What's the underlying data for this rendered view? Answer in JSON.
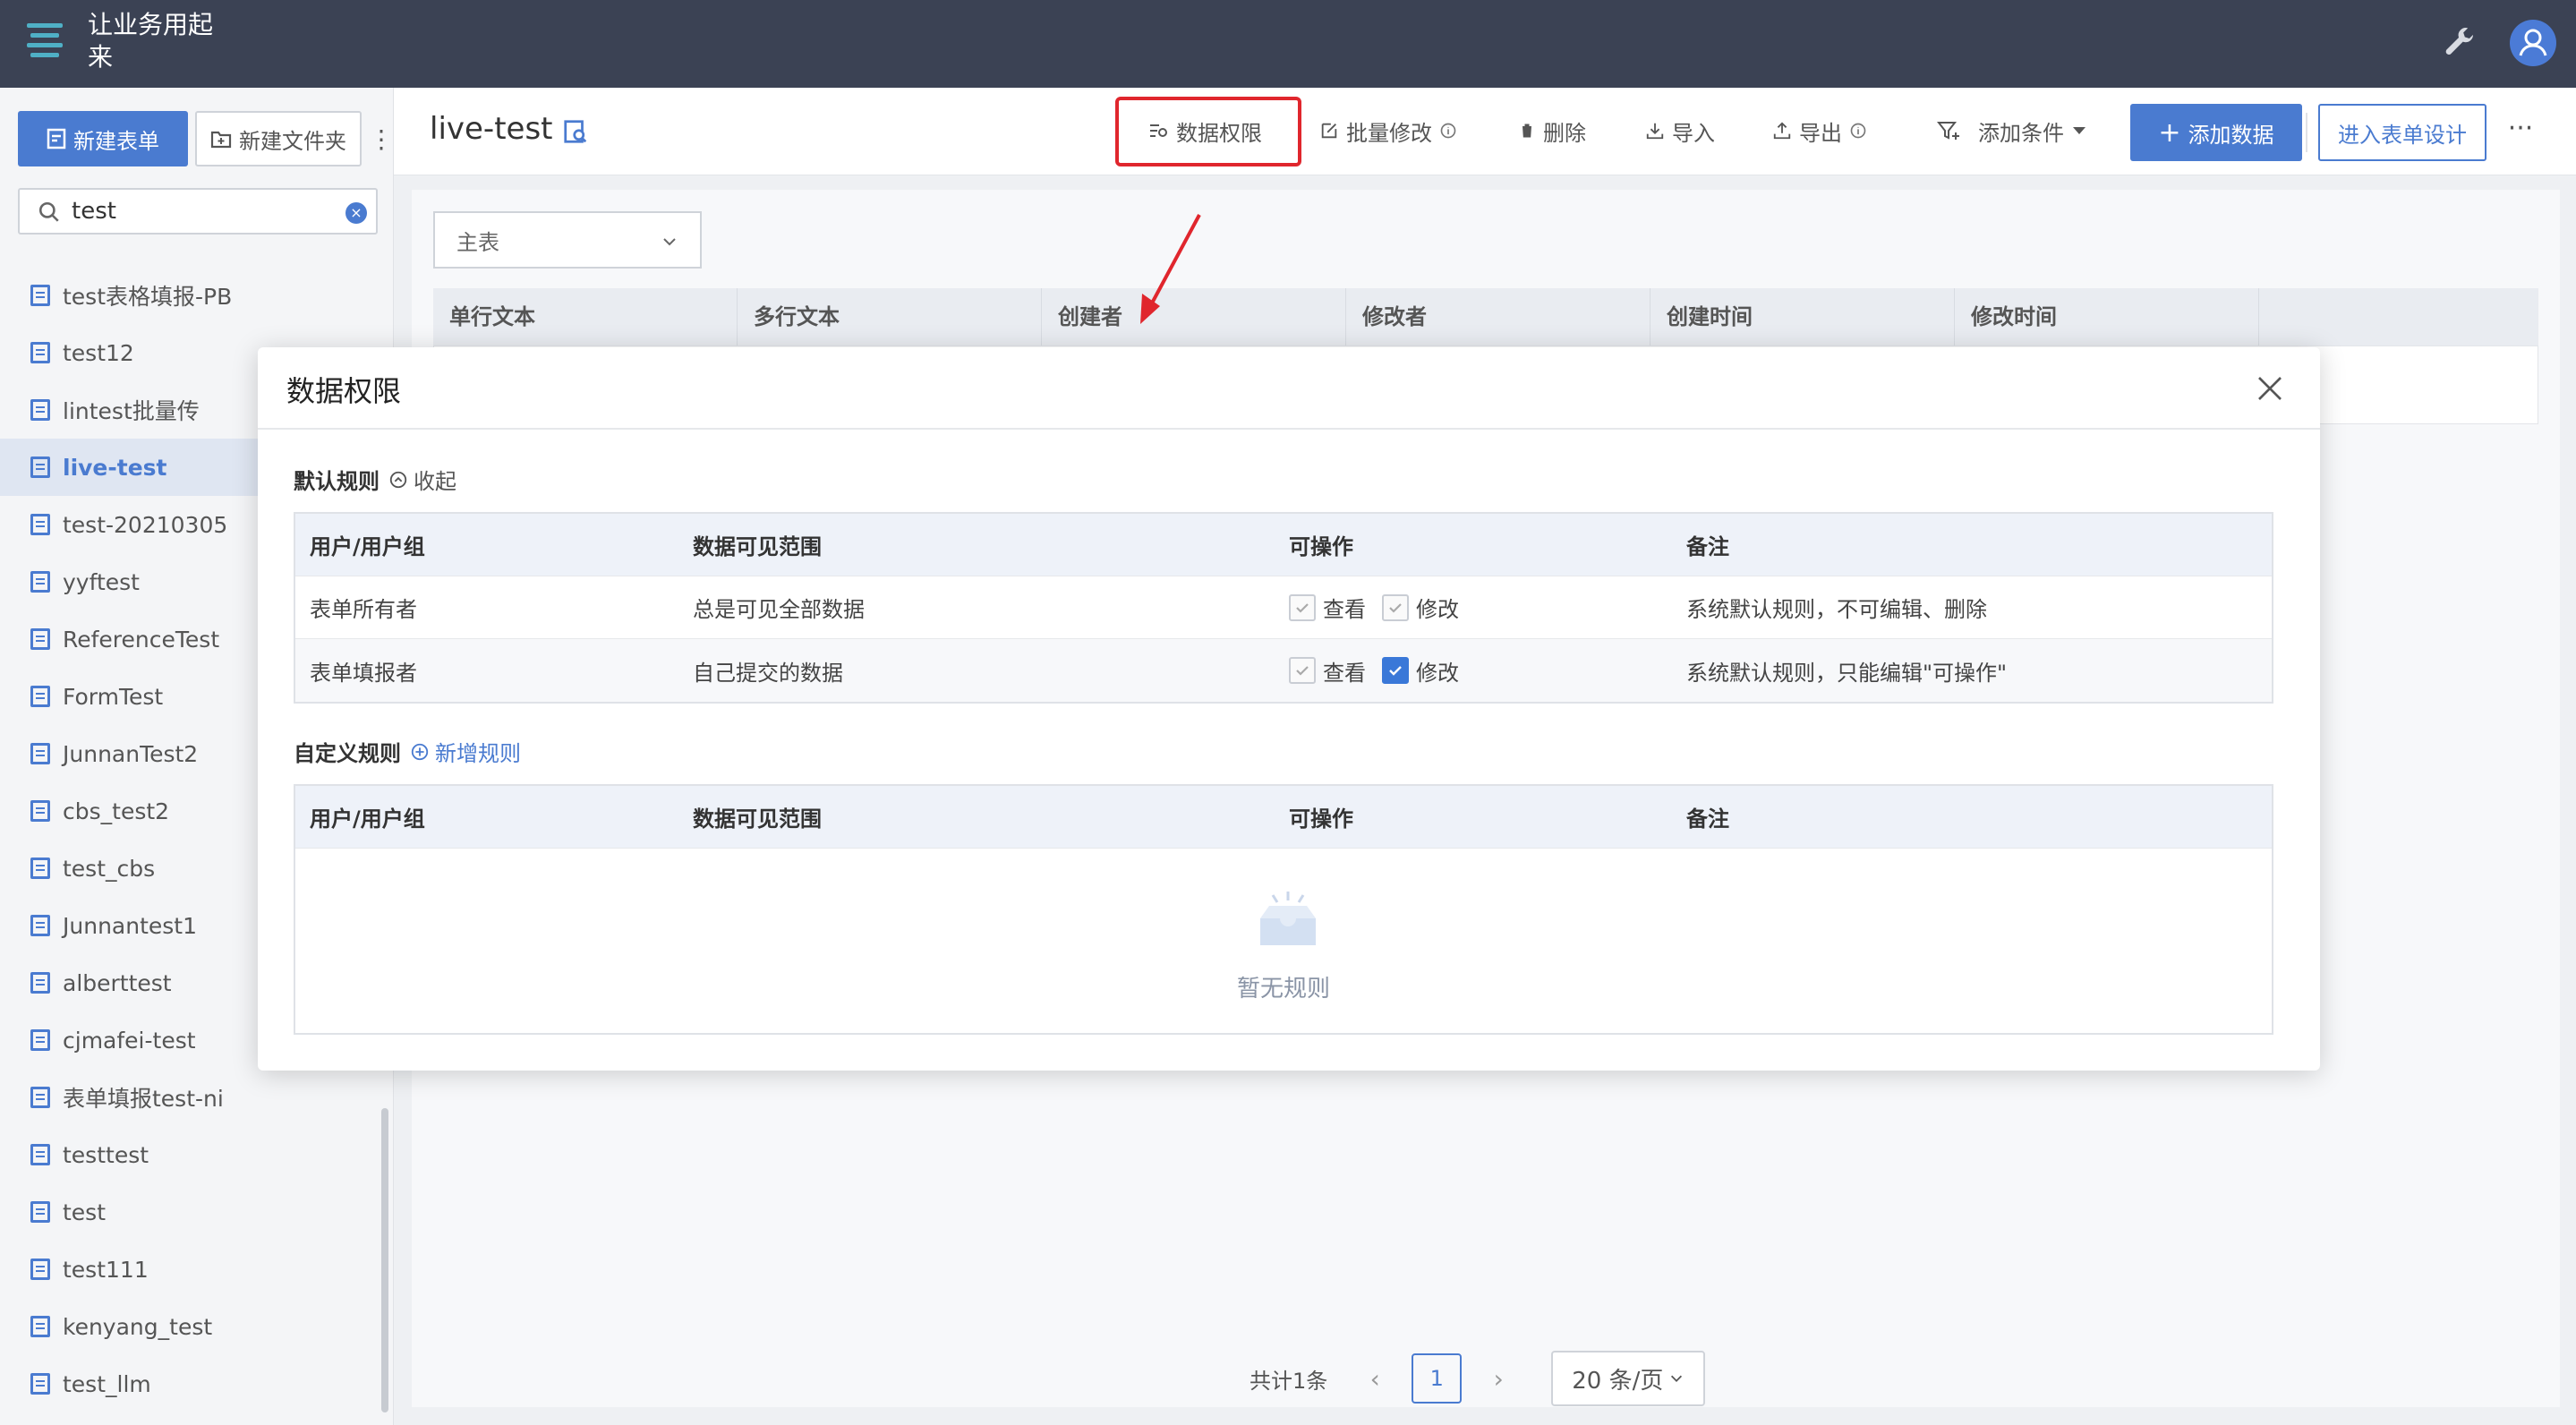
{
  "app": {
    "title": "让业务用起来"
  },
  "sidebar": {
    "new_form_label": "新建表单",
    "new_folder_label": "新建文件夹",
    "search": {
      "value": "test",
      "placeholder": ""
    },
    "items": [
      {
        "label": "test表格填报-PB",
        "active": false
      },
      {
        "label": "test12",
        "active": false
      },
      {
        "label": "lintest批量传",
        "active": false
      },
      {
        "label": "live-test",
        "active": true
      },
      {
        "label": "test-20210305",
        "active": false
      },
      {
        "label": "yyftest",
        "active": false
      },
      {
        "label": "ReferenceTest",
        "active": false
      },
      {
        "label": "FormTest",
        "active": false
      },
      {
        "label": "JunnanTest2",
        "active": false
      },
      {
        "label": "cbs_test2",
        "active": false
      },
      {
        "label": "test_cbs",
        "active": false
      },
      {
        "label": "Junnantest1",
        "active": false
      },
      {
        "label": "alberttest",
        "active": false
      },
      {
        "label": "cjmafei-test",
        "active": false
      },
      {
        "label": "表单填报test-ni",
        "active": false
      },
      {
        "label": "testtest",
        "active": false
      },
      {
        "label": "test",
        "active": false
      },
      {
        "label": "test111",
        "active": false
      },
      {
        "label": "kenyang_test",
        "active": false
      },
      {
        "label": "test_llm",
        "active": false
      }
    ]
  },
  "header": {
    "title": "live-test",
    "data_permission_label": "数据权限",
    "batch_edit_label": "批量修改",
    "delete_label": "删除",
    "import_label": "导入",
    "export_label": "导出",
    "add_condition_label": "添加条件",
    "add_data_label": "添加数据",
    "design_label": "进入表单设计"
  },
  "content": {
    "table_select": "主表",
    "columns": [
      "单行文本",
      "多行文本",
      "创建者",
      "修改者",
      "创建时间",
      "修改时间"
    ]
  },
  "pagination": {
    "total": "共计1条",
    "page": "1",
    "page_size": "20 条/页"
  },
  "modal": {
    "title": "数据权限",
    "default_rules_label": "默认规则",
    "collapse_label": "收起",
    "custom_rules_label": "自定义规则",
    "add_rule_label": "新增规则",
    "columns": [
      "用户/用户组",
      "数据可见范围",
      "可操作",
      "备注"
    ],
    "default_rules": [
      {
        "group": "表单所有者",
        "scope": "总是可见全部数据",
        "view_label": "查看",
        "edit_label": "修改",
        "note": "系统默认规则，不可编辑、删除"
      },
      {
        "group": "表单填报者",
        "scope": "自己提交的数据",
        "view_label": "查看",
        "edit_label": "修改",
        "note": "系统默认规则，只能编辑\"可操作\""
      }
    ],
    "empty_text": "暂无规则"
  },
  "colors": {
    "primary": "#4a7bd0",
    "topbar": "#3b4254",
    "highlight": "#e0262d"
  }
}
